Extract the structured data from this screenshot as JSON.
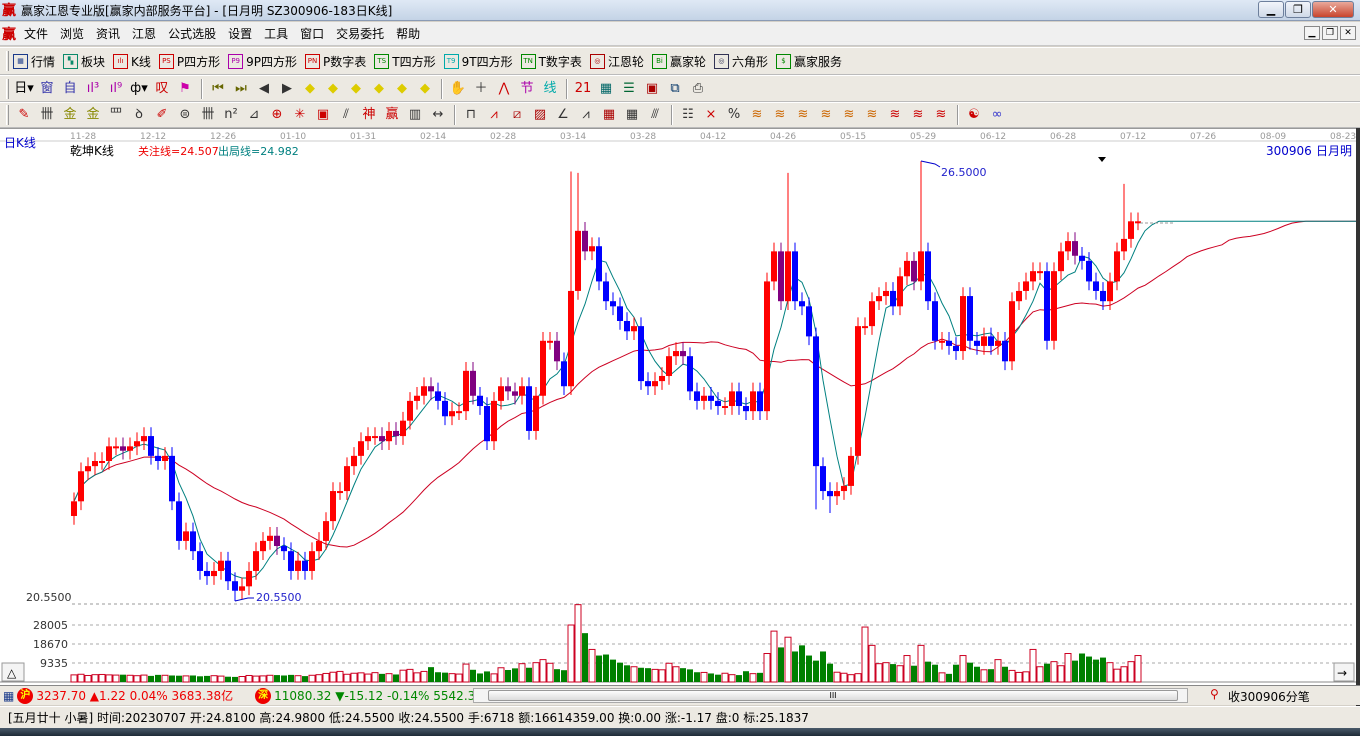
{
  "window": {
    "title": "赢家江恩专业版[赢家内部服务平台] - [日月明  SZ300906-183日K线]",
    "logo": "赢",
    "controls": [
      "minimize",
      "maximize",
      "close"
    ]
  },
  "menu": {
    "logo": "赢",
    "items": [
      "文件",
      "浏览",
      "资讯",
      "江恩",
      "公式选股",
      "设置",
      "工具",
      "窗口",
      "交易委托",
      "帮助"
    ]
  },
  "toolbar1": [
    {
      "icon": "table-icon",
      "badge": "▦",
      "color": "#1a3a8a",
      "label": "行情"
    },
    {
      "icon": "blocks-icon",
      "badge": "▚",
      "color": "#0a8a6a",
      "label": "板块"
    },
    {
      "icon": "candles-icon",
      "badge": "ılı",
      "color": "#c00",
      "label": "K线"
    },
    {
      "icon": "ps-icon",
      "badge": "PS",
      "color": "#c00",
      "label": "P四方形"
    },
    {
      "icon": "p9-icon",
      "badge": "P9",
      "color": "#a0a",
      "label": "9P四方形"
    },
    {
      "icon": "pn-icon",
      "badge": "PN",
      "color": "#c00",
      "label": "P数字表"
    },
    {
      "icon": "ts-icon",
      "badge": "TS",
      "color": "#080",
      "label": "T四方形"
    },
    {
      "icon": "t9-icon",
      "badge": "T9",
      "color": "#0aa",
      "label": "9T四方形"
    },
    {
      "icon": "tn-icon",
      "badge": "TN",
      "color": "#080",
      "label": "T数字表"
    },
    {
      "icon": "gann-wheel-icon",
      "badge": "◎",
      "color": "#a00",
      "label": "江恩轮"
    },
    {
      "icon": "winner-wheel-icon",
      "badge": "Bi",
      "color": "#080",
      "label": "赢家轮"
    },
    {
      "icon": "hexagon-icon",
      "badge": "◎",
      "color": "#335",
      "label": "六角形"
    },
    {
      "icon": "dollar-icon",
      "badge": "$",
      "color": "#080",
      "label": "赢家服务"
    }
  ],
  "toolbar2": [
    {
      "icon": "period-dropdown-icon",
      "glyph": "日▾",
      "color": "#000"
    },
    {
      "icon": "window-icon",
      "glyph": "窗",
      "color": "#33a"
    },
    {
      "icon": "self-icon",
      "glyph": "自",
      "color": "#33a"
    },
    {
      "icon": "chart3-icon",
      "glyph": "ıl³",
      "color": "#a0a"
    },
    {
      "icon": "chart9-icon",
      "glyph": "ıl⁹",
      "color": "#a0a"
    },
    {
      "icon": "candle-dropdown-icon",
      "glyph": "ф▾",
      "color": "#000"
    },
    {
      "icon": "diagonal-icon",
      "glyph": "叹",
      "color": "#c00"
    },
    {
      "icon": "flag-icon",
      "glyph": "⚑",
      "color": "#c0a"
    },
    "sep",
    {
      "icon": "first-icon",
      "glyph": "⏮",
      "color": "#660"
    },
    {
      "icon": "last-icon",
      "glyph": "⏭",
      "color": "#660"
    },
    {
      "icon": "left-icon",
      "glyph": "◀",
      "color": "#333"
    },
    {
      "icon": "right-icon",
      "glyph": "▶",
      "color": "#333"
    },
    {
      "icon": "diamond-left-icon",
      "glyph": "◆",
      "color": "#dc0"
    },
    {
      "icon": "diamond-right-icon",
      "glyph": "◆",
      "color": "#dc0"
    },
    {
      "icon": "diamond-h-icon",
      "glyph": "◆",
      "color": "#dc0"
    },
    {
      "icon": "diamond-x-icon",
      "glyph": "◆",
      "color": "#dc0"
    },
    {
      "icon": "diamond-star-icon",
      "glyph": "◆",
      "color": "#dc0"
    },
    {
      "icon": "diamond-v-icon",
      "glyph": "◆",
      "color": "#dc0"
    },
    "sep",
    {
      "icon": "hand-icon",
      "glyph": "✋",
      "color": "#333"
    },
    {
      "icon": "crosshair-icon",
      "glyph": "＋",
      "color": "#333"
    },
    {
      "icon": "line-tool-icon",
      "glyph": "⋀",
      "color": "#c00"
    },
    {
      "icon": "node-icon",
      "glyph": "节",
      "color": "#a0a"
    },
    {
      "icon": "wave-icon",
      "glyph": "线",
      "color": "#0aa"
    },
    "sep",
    {
      "icon": "calendar-icon",
      "glyph": "21",
      "color": "#c00"
    },
    {
      "icon": "calculator-icon",
      "glyph": "▦",
      "color": "#066"
    },
    {
      "icon": "notes-icon",
      "glyph": "☰",
      "color": "#063"
    },
    {
      "icon": "save-icon",
      "glyph": "▣",
      "color": "#a00"
    },
    {
      "icon": "network-icon",
      "glyph": "⧉",
      "color": "#036"
    },
    {
      "icon": "print-icon",
      "glyph": "⎙",
      "color": "#333"
    }
  ],
  "toolbar3": [
    {
      "icon": "pen-icon",
      "glyph": "✎",
      "color": "#c00"
    },
    {
      "icon": "grid-icon",
      "glyph": "卌",
      "color": "#333"
    },
    {
      "icon": "gold-icon",
      "glyph": "金",
      "color": "#880"
    },
    {
      "icon": "gold2-icon",
      "glyph": "金",
      "color": "#880"
    },
    {
      "icon": "fib-icon",
      "glyph": "罒",
      "color": "#333"
    },
    {
      "icon": "spiral-icon",
      "glyph": "ꝺ",
      "color": "#333"
    },
    {
      "icon": "brush-icon",
      "glyph": "✐",
      "color": "#c00"
    },
    {
      "icon": "circle-icon",
      "glyph": "⊜",
      "color": "#333"
    },
    {
      "icon": "lines-icon",
      "glyph": "卌",
      "color": "#333"
    },
    {
      "icon": "n2-icon",
      "glyph": "n²",
      "color": "#333"
    },
    {
      "icon": "fan-icon",
      "glyph": "⊿",
      "color": "#333"
    },
    {
      "icon": "target-icon",
      "glyph": "⊕",
      "color": "#c00"
    },
    {
      "icon": "star-icon",
      "glyph": "✳",
      "color": "#c00"
    },
    {
      "icon": "square-icon",
      "glyph": "▣",
      "color": "#c00"
    },
    {
      "icon": "slash-icon",
      "glyph": "⫽",
      "color": "#333"
    },
    {
      "icon": "shen-icon",
      "glyph": "神",
      "color": "#c00"
    },
    {
      "icon": "ying-icon",
      "glyph": "赢",
      "color": "#c00"
    },
    {
      "icon": "bars-icon",
      "glyph": "▥",
      "color": "#333"
    },
    {
      "icon": "arrows-icon",
      "glyph": "↔",
      "color": "#333"
    },
    "sep",
    {
      "icon": "box-icon",
      "glyph": "⊓",
      "color": "#333"
    },
    {
      "icon": "rays-icon",
      "glyph": "⩘",
      "color": "#c00"
    },
    {
      "icon": "diag-square-icon",
      "glyph": "⧄",
      "color": "#a00"
    },
    {
      "icon": "hatch-icon",
      "glyph": "▨",
      "color": "#a00"
    },
    {
      "icon": "angle-icon",
      "glyph": "∠",
      "color": "#333"
    },
    {
      "icon": "zigzag-icon",
      "glyph": "⩘",
      "color": "#333"
    },
    {
      "icon": "mesh-icon",
      "glyph": "▦",
      "color": "#a00"
    },
    {
      "icon": "mesh2-icon",
      "glyph": "▦",
      "color": "#333"
    },
    {
      "icon": "parallel-icon",
      "glyph": "⫻",
      "color": "#333"
    },
    "sep",
    {
      "icon": "table2-icon",
      "glyph": "☷",
      "color": "#333"
    },
    {
      "icon": "cross-pct-icon",
      "glyph": "⨯",
      "color": "#c00"
    },
    {
      "icon": "percent-icon",
      "glyph": "%",
      "color": "#333"
    },
    {
      "icon": "golden1-icon",
      "glyph": "≋",
      "color": "#c60"
    },
    {
      "icon": "golden2-icon",
      "glyph": "≋",
      "color": "#c60"
    },
    {
      "icon": "golden3-icon",
      "glyph": "≋",
      "color": "#c60"
    },
    {
      "icon": "golden4-icon",
      "glyph": "≋",
      "color": "#c60"
    },
    {
      "icon": "golden5-icon",
      "glyph": "≋",
      "color": "#c60"
    },
    {
      "icon": "golden6-icon",
      "glyph": "≋",
      "color": "#c60"
    },
    {
      "icon": "golden7-icon",
      "glyph": "≋",
      "color": "#c00"
    },
    {
      "icon": "golden8-icon",
      "glyph": "≋",
      "color": "#c00"
    },
    {
      "icon": "golden9-icon",
      "glyph": "≋",
      "color": "#c00"
    },
    "sep",
    {
      "icon": "yinyang-icon",
      "glyph": "☯",
      "color": "#c00"
    },
    {
      "icon": "infinity-icon",
      "glyph": "∞",
      "color": "#33c"
    }
  ],
  "chart_header": {
    "period": "日K线",
    "indicator": "乾坤K线",
    "focus_line": "关注线=24.507",
    "exit_line": "出局线=24.982",
    "code": "300906",
    "name": "日月明",
    "high_label": "26.5000",
    "low_label": "20.5500",
    "axis_low": "20.5500"
  },
  "colors": {
    "up": "#ff0000",
    "down": "#0000ff",
    "down_alt": "#800080",
    "ma_short": "#008080",
    "ma_long": "#cc0022",
    "vol_up": "#cc0022",
    "vol_down": "#008000"
  },
  "chart_data": {
    "type": "candlestick",
    "dates": [
      "11-28",
      "12-12",
      "12-26",
      "01-10",
      "01-31",
      "02-14",
      "02-28",
      "03-14",
      "03-28",
      "04-12",
      "04-26",
      "05-15",
      "05-29",
      "06-12",
      "06-28",
      "07-12",
      "07-26",
      "08-09",
      "08-23"
    ],
    "ylim": [
      20.55,
      26.55
    ],
    "close": [
      21.91,
      22.32,
      22.39,
      22.46,
      22.46,
      22.66,
      22.66,
      22.6,
      22.66,
      22.73,
      22.8,
      22.53,
      22.46,
      22.53,
      21.91,
      21.37,
      21.5,
      21.23,
      20.96,
      20.89,
      20.96,
      21.1,
      20.82,
      20.69,
      20.75,
      20.96,
      21.23,
      21.37,
      21.44,
      21.3,
      21.23,
      20.96,
      21.1,
      20.96,
      21.23,
      21.37,
      21.64,
      22.05,
      22.05,
      22.39,
      22.53,
      22.73,
      22.8,
      22.8,
      22.73,
      22.87,
      22.8,
      23.01,
      23.28,
      23.35,
      23.48,
      23.41,
      23.28,
      23.07,
      23.14,
      23.14,
      23.69,
      23.35,
      23.21,
      22.73,
      23.28,
      23.48,
      23.41,
      23.35,
      23.48,
      22.87,
      23.35,
      24.1,
      24.1,
      23.82,
      23.48,
      24.78,
      25.6,
      25.32,
      25.39,
      24.91,
      24.64,
      24.57,
      24.37,
      24.23,
      24.3,
      23.55,
      23.48,
      23.55,
      23.62,
      23.89,
      23.96,
      23.89,
      23.41,
      23.28,
      23.35,
      23.28,
      23.21,
      23.21,
      23.41,
      23.21,
      23.14,
      23.41,
      23.14,
      24.91,
      25.32,
      24.64,
      25.32,
      24.64,
      24.57,
      24.16,
      22.39,
      22.05,
      21.98,
      22.05,
      22.12,
      22.53,
      24.3,
      24.3,
      24.64,
      24.71,
      24.78,
      24.57,
      24.98,
      25.19,
      24.91,
      25.32,
      24.64,
      24.1,
      24.1,
      24.03,
      23.96,
      24.71,
      24.1,
      24.03,
      24.16,
      24.03,
      24.1,
      23.82,
      24.64,
      24.78,
      24.91,
      25.05,
      25.05,
      24.1,
      25.05,
      25.32,
      25.46,
      25.26,
      25.19,
      24.91,
      24.78,
      24.64,
      24.91,
      25.32,
      25.49,
      25.73,
      25.73
    ],
    "high_overrides": {
      "71": 26.41,
      "72": 26.39,
      "102": 26.39,
      "121": 26.55,
      "150": 26.24
    },
    "low_overrides": {
      "23": 20.55,
      "106": 21.8,
      "108": 21.75
    },
    "volume": [
      3500,
      3800,
      3200,
      3600,
      3700,
      3500,
      3400,
      3600,
      3300,
      3100,
      3400,
      3000,
      3500,
      3300,
      3200,
      3100,
      3000,
      3200,
      2800,
      3000,
      3100,
      2900,
      2600,
      2500,
      2700,
      3200,
      2900,
      3000,
      3300,
      3400,
      3200,
      3500,
      3100,
      2900,
      3300,
      3600,
      4200,
      4800,
      5200,
      3800,
      4300,
      4500,
      3900,
      4600,
      4000,
      4100,
      3700,
      5800,
      6200,
      4500,
      5200,
      7300,
      4800,
      4600,
      4100,
      3900,
      8800,
      6000,
      4200,
      5200,
      4000,
      7000,
      5900,
      6700,
      9000,
      7000,
      9500,
      11000,
      9200,
      6300,
      5800,
      28000,
      38000,
      24000,
      16000,
      13000,
      13500,
      11000,
      9500,
      8200,
      7500,
      7000,
      6800,
      6200,
      6000,
      9200,
      7500,
      6800,
      6200,
      4800,
      4700,
      4200,
      3600,
      4300,
      3600,
      3400,
      5300,
      4100,
      4500,
      14000,
      25000,
      17000,
      22000,
      15000,
      18000,
      13000,
      10500,
      15000,
      9000,
      4800,
      4300,
      3600,
      4100,
      27000,
      18000,
      9000,
      9500,
      8800,
      8000,
      13000,
      8000,
      18000,
      10000,
      8500,
      4500,
      4000,
      8500,
      13000,
      9500,
      7500,
      6000,
      6300,
      11000,
      7500,
      5700,
      4700,
      5000,
      16000,
      7500,
      9000,
      10000,
      8000,
      14000,
      10500,
      14000,
      12500,
      11000,
      12000,
      9500,
      6300,
      7500,
      10000,
      13000,
      19000,
      13000,
      8000
    ],
    "volume_ticks": [
      "9335",
      "18670",
      "28005"
    ],
    "volume_tick_values": [
      9335,
      18670,
      28005
    ],
    "ma_short_period": 5,
    "ma_long_period": 26
  },
  "status": {
    "sh_badge": "沪",
    "sh_index": "3237.70",
    "sh_change": "▲1.22",
    "sh_pct": "0.04%",
    "sh_amount": "3683.38亿",
    "sz_badge": "深",
    "sz_index": "11080.32",
    "sz_change": "▼-15.12",
    "sz_pct": "-0.14%",
    "sz_amount": "5542.3",
    "scroll_thumb": "III",
    "ticks_label": "收300906分笔",
    "info": "[五月廿十 小暑] 时间:20230707 开:24.8100 高:24.9800 低:24.5500 收:24.5500 手:6718 额:16614359.00 换:0.00 涨:-1.17 盘:0 标:25.1837",
    "up_button": "△",
    "right_button": "→"
  }
}
